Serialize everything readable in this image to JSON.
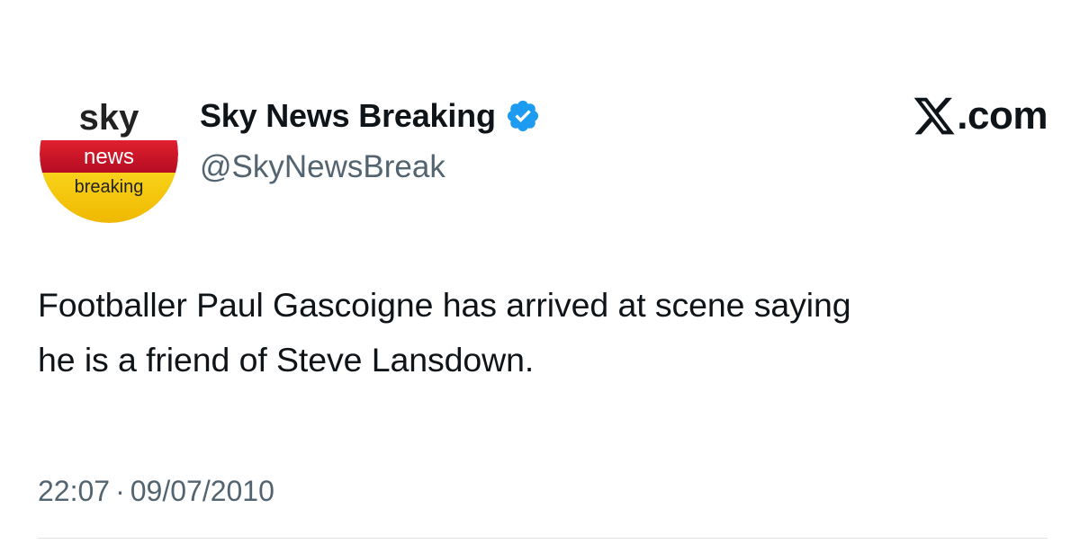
{
  "account": {
    "display_name": "Sky News Breaking",
    "handle": "@SkyNewsBreak",
    "verified": true,
    "verified_badge_color": "#1d9bf0",
    "avatar": {
      "icon": "sky-news-breaking-logo",
      "logo_line1": "sky",
      "logo_line2": "news",
      "logo_line3": "breaking",
      "colors": {
        "top": "#ffffff",
        "band": "#c8102e",
        "bottom": "#f5c400"
      }
    }
  },
  "brand": {
    "icon": "x-logo-icon",
    "label": ".com"
  },
  "tweet": {
    "lines": [
      "Footballer Paul Gascoigne has arrived at scene saying",
      "he is a friend of Steve Lansdown."
    ],
    "time": "22:07",
    "separator": "·",
    "date": "09/07/2010"
  },
  "colors": {
    "text_primary": "#0f1419",
    "text_secondary": "#536471",
    "divider": "#dfe3e6"
  }
}
